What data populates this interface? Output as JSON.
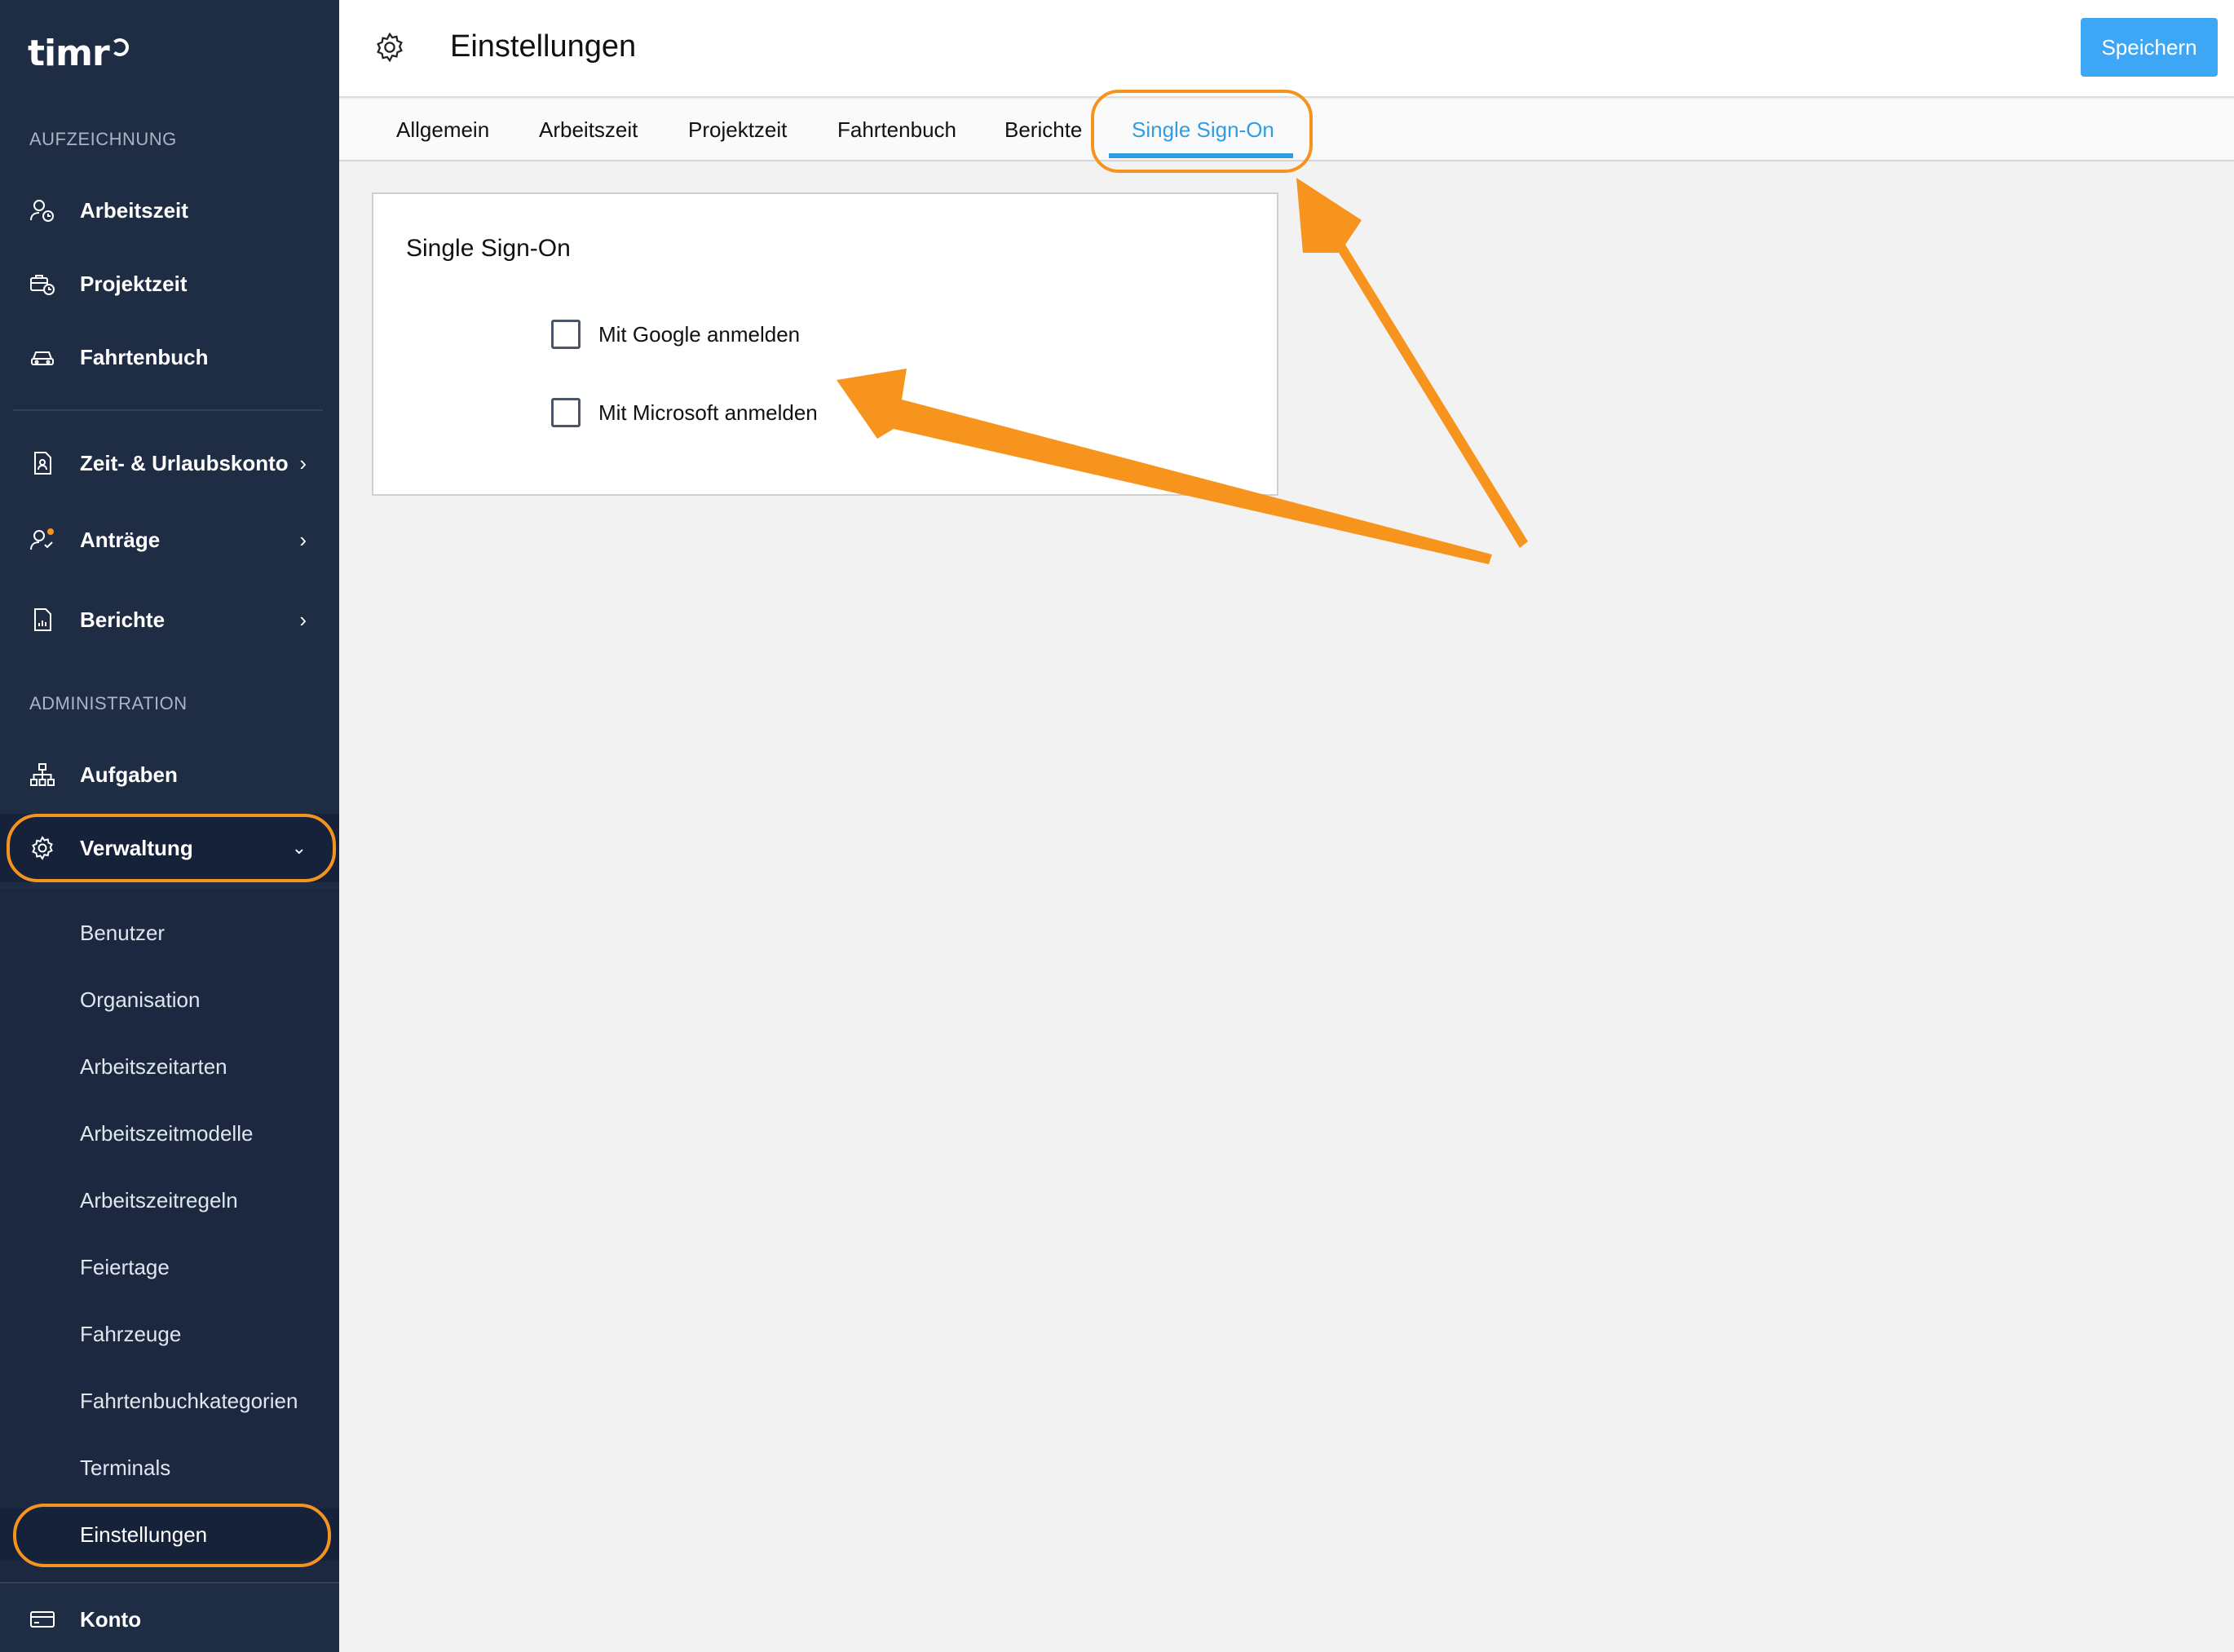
{
  "app": {
    "logo_text": "timr"
  },
  "sidebar": {
    "section_recording": "AUFZEICHNUNG",
    "section_admin": "ADMINISTRATION",
    "items": {
      "arbeitszeit": "Arbeitszeit",
      "projektzeit": "Projektzeit",
      "fahrtenbuch": "Fahrtenbuch",
      "urlaubskonto": "Zeit- & Urlaubskonto",
      "antraege": "Anträge",
      "berichte": "Berichte",
      "aufgaben": "Aufgaben",
      "verwaltung": "Verwaltung",
      "konto": "Konto"
    },
    "subitems": [
      "Benutzer",
      "Organisation",
      "Arbeitszeitarten",
      "Arbeitszeitmodelle",
      "Arbeitszeitregeln",
      "Feiertage",
      "Fahrzeuge",
      "Fahrtenbuchkategorien",
      "Terminals",
      "Einstellungen"
    ]
  },
  "header": {
    "title": "Einstellungen",
    "save_label": "Speichern"
  },
  "tabs": [
    "Allgemein",
    "Arbeitszeit",
    "Projektzeit",
    "Fahrtenbuch",
    "Berichte",
    "Single Sign-On"
  ],
  "sso": {
    "title": "Single Sign-On",
    "google_label": "Mit Google anmelden",
    "microsoft_label": "Mit Microsoft anmelden",
    "google_checked": false,
    "microsoft_checked": false
  },
  "colors": {
    "sidebar": "#1e2c44",
    "accent": "#3ea7f5",
    "annotation": "#f5931f"
  }
}
